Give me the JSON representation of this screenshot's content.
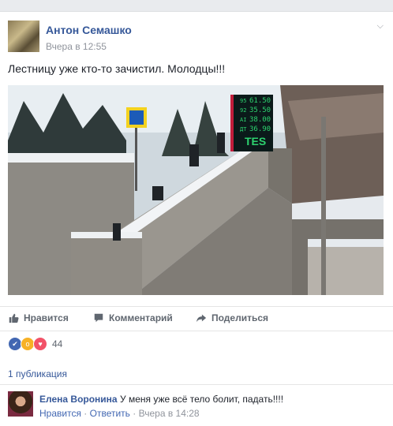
{
  "post": {
    "author": "Антон Семашко",
    "time": "Вчера в 12:55",
    "text": "Лестницу уже кто-то зачистил. Молодцы!!!"
  },
  "sign": {
    "prices": [
      "61.50",
      "35.50",
      "38.00",
      "36.90"
    ],
    "labels": [
      "95",
      "92",
      "AI",
      "ДТ"
    ],
    "brand": "TES"
  },
  "actions": {
    "like": "Нравится",
    "comment": "Комментарий",
    "share": "Поделиться"
  },
  "reactions": {
    "count": "44",
    "colors": {
      "like": "#4267b2",
      "wow": "#f7b125",
      "love": "#f25268"
    }
  },
  "shares": "1 публикация",
  "comment": {
    "author": "Елена Воронина",
    "text": "У меня уже всё тело болит, падать!!!!",
    "like": "Нравится",
    "reply": "Ответить",
    "time": "Вчера в 14:28"
  }
}
